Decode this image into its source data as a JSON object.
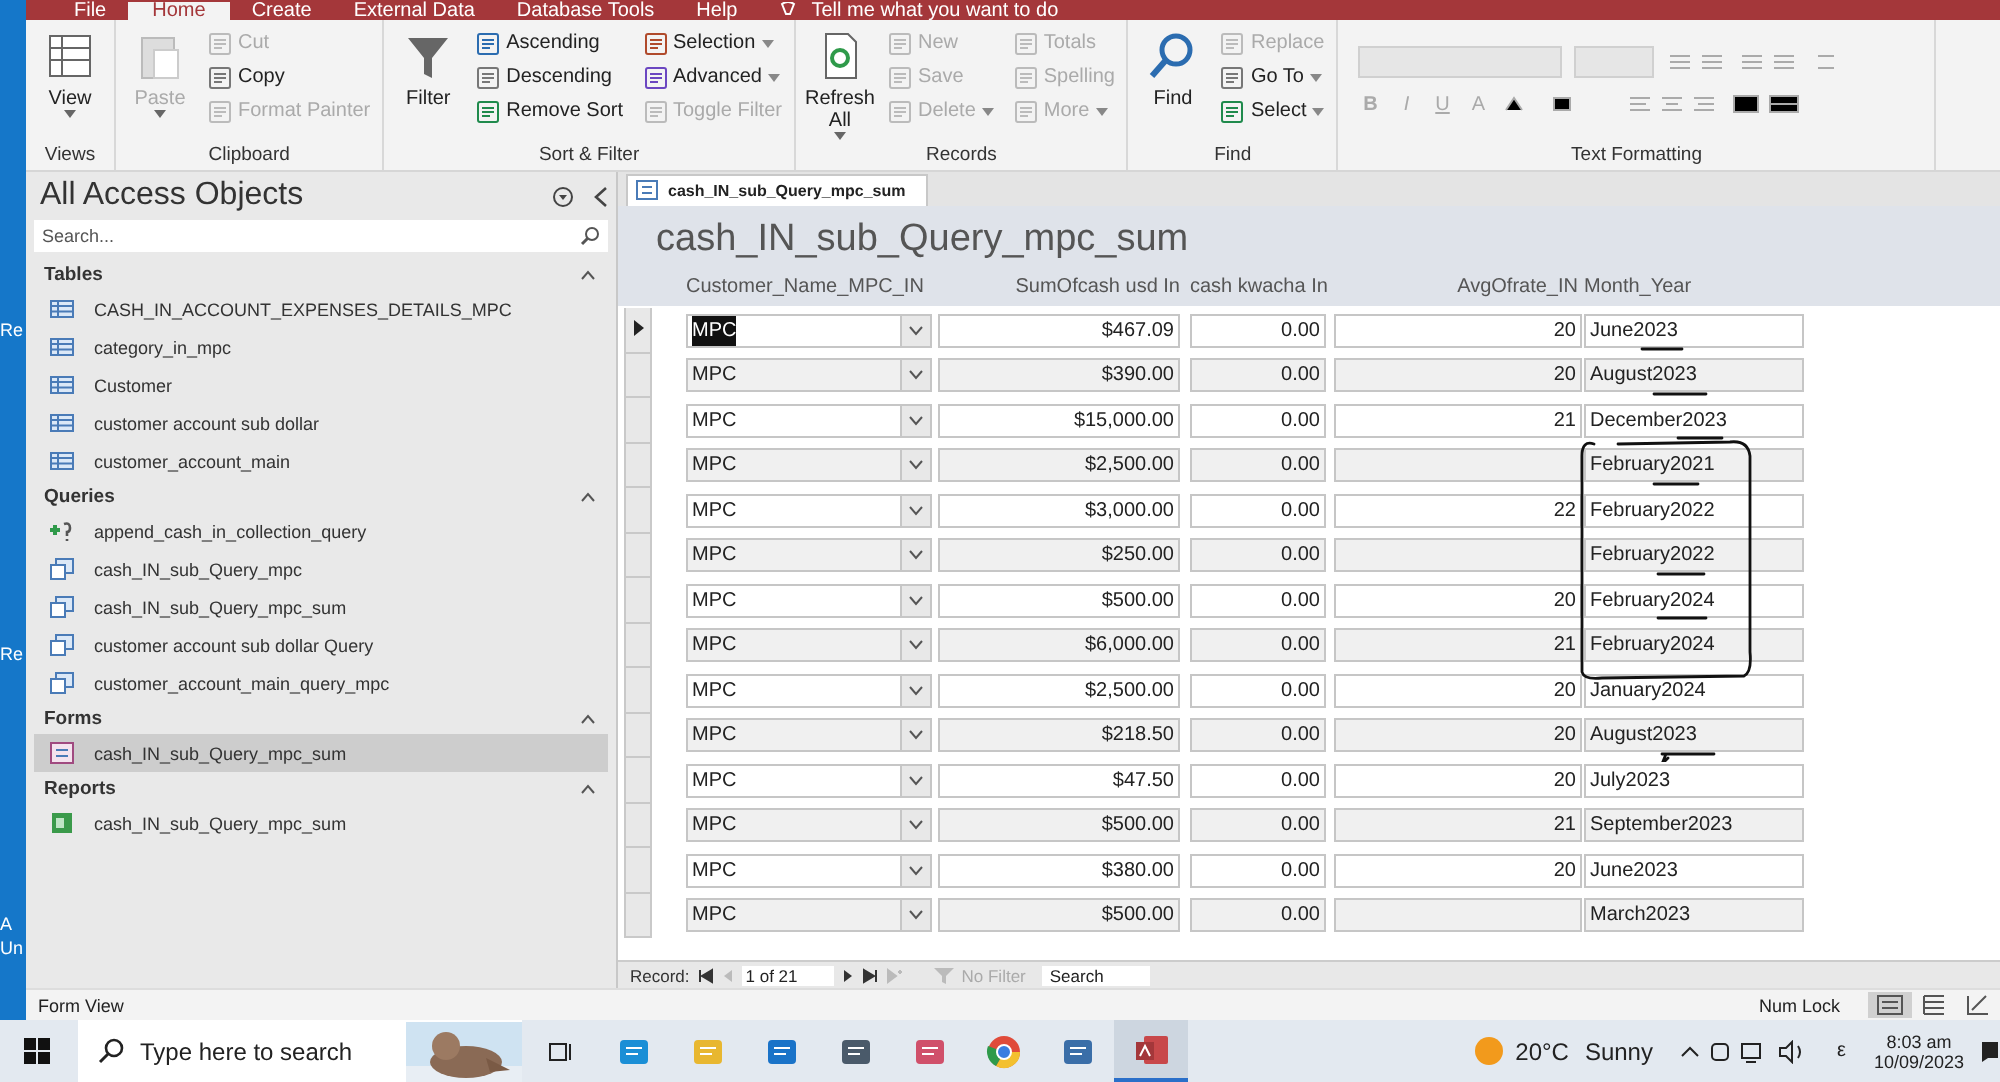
{
  "desktop_labels": [
    "Re",
    "Re",
    "A",
    "Un"
  ],
  "ribbon": {
    "tabs": [
      {
        "label": "File",
        "selected": false
      },
      {
        "label": "Home",
        "selected": true
      },
      {
        "label": "Create",
        "selected": false
      },
      {
        "label": "External Data",
        "selected": false
      },
      {
        "label": "Database Tools",
        "selected": false
      },
      {
        "label": "Help",
        "selected": false
      }
    ],
    "tell_me": "Tell me what you want to do",
    "groups": [
      {
        "label": "Views",
        "large": [
          {
            "label": "View",
            "dropdown": true,
            "disabled": false
          }
        ]
      },
      {
        "label": "Clipboard",
        "large": [
          {
            "label": "Paste",
            "dropdown": true,
            "disabled": true
          }
        ],
        "small": [
          {
            "label": "Cut",
            "dropdown": false,
            "disabled": true
          },
          {
            "label": "Copy",
            "dropdown": false,
            "disabled": false
          },
          {
            "label": "Format Painter",
            "dropdown": false,
            "disabled": true
          }
        ]
      },
      {
        "label": "Sort & Filter",
        "large": [
          {
            "label": "Filter",
            "dropdown": false,
            "disabled": false
          }
        ],
        "small": [
          {
            "label": "Ascending",
            "dropdown": false,
            "disabled": false
          },
          {
            "label": "Descending",
            "dropdown": false,
            "disabled": false
          },
          {
            "label": "Remove Sort",
            "dropdown": false,
            "disabled": false
          },
          {
            "label": "Selection",
            "dropdown": true,
            "disabled": false
          },
          {
            "label": "Advanced",
            "dropdown": true,
            "disabled": false
          },
          {
            "label": "Toggle Filter",
            "dropdown": false,
            "disabled": true
          }
        ]
      },
      {
        "label": "Records",
        "large": [
          {
            "label": "Refresh All",
            "dropdown": true,
            "disabled": false
          }
        ],
        "small": [
          {
            "label": "New",
            "dropdown": false,
            "disabled": true
          },
          {
            "label": "Save",
            "dropdown": false,
            "disabled": true
          },
          {
            "label": "Delete",
            "dropdown": true,
            "disabled": true
          },
          {
            "label": "Totals",
            "dropdown": false,
            "disabled": true
          },
          {
            "label": "Spelling",
            "dropdown": false,
            "disabled": true
          },
          {
            "label": "More",
            "dropdown": true,
            "disabled": true
          }
        ]
      },
      {
        "label": "Find",
        "large": [
          {
            "label": "Find",
            "dropdown": false,
            "disabled": false
          }
        ],
        "small": [
          {
            "label": "Replace",
            "dropdown": false,
            "disabled": true
          },
          {
            "label": "Go To",
            "dropdown": true,
            "disabled": false
          },
          {
            "label": "Select",
            "dropdown": true,
            "disabled": false
          }
        ]
      }
    ],
    "text_formatting": {
      "label": "Text Formatting",
      "letters": [
        "B",
        "I",
        "U",
        "A"
      ]
    }
  },
  "nav": {
    "title": "All Access Objects",
    "search_placeholder": "Search...",
    "sections": [
      {
        "label": "Tables",
        "items": [
          {
            "label": "CASH_IN_ACCOUNT_EXPENSES_DETAILS_MPC",
            "kind": "table",
            "selected": false
          },
          {
            "label": "category_in_mpc",
            "kind": "table",
            "selected": false
          },
          {
            "label": "Customer",
            "kind": "table",
            "selected": false
          },
          {
            "label": "customer account sub dollar",
            "kind": "table",
            "selected": false
          },
          {
            "label": "customer_account_main",
            "kind": "table",
            "selected": false
          }
        ]
      },
      {
        "label": "Queries",
        "items": [
          {
            "label": "append_cash_in_collection_query",
            "kind": "append",
            "selected": false
          },
          {
            "label": "cash_IN_sub_Query_mpc",
            "kind": "query",
            "selected": false
          },
          {
            "label": "cash_IN_sub_Query_mpc_sum",
            "kind": "query",
            "selected": false
          },
          {
            "label": "customer account sub dollar Query",
            "kind": "query",
            "selected": false
          },
          {
            "label": "customer_account_main_query_mpc",
            "kind": "query",
            "selected": false
          }
        ]
      },
      {
        "label": "Forms",
        "items": [
          {
            "label": "cash_IN_sub_Query_mpc_sum",
            "kind": "form",
            "selected": true
          }
        ]
      },
      {
        "label": "Reports",
        "items": [
          {
            "label": "cash_IN_sub_Query_mpc_sum",
            "kind": "report",
            "selected": false
          }
        ]
      }
    ]
  },
  "form": {
    "tab": "cash_IN_sub_Query_mpc_sum",
    "title": "cash_IN_sub_Query_mpc_sum",
    "columns": [
      "Customer_Name_MPC_IN",
      "SumOfcash usd In",
      "cash kwacha In",
      "AvgOfrate_IN",
      "Month_Year"
    ],
    "rows": [
      {
        "name": "MPC",
        "usd": "$467.09",
        "kwacha": "0.00",
        "rate": "20",
        "month": "June2023",
        "selected": true
      },
      {
        "name": "MPC",
        "usd": "$390.00",
        "kwacha": "0.00",
        "rate": "20",
        "month": "August2023",
        "selected": false
      },
      {
        "name": "MPC",
        "usd": "$15,000.00",
        "kwacha": "0.00",
        "rate": "21",
        "month": "December2023",
        "selected": false
      },
      {
        "name": "MPC",
        "usd": "$2,500.00",
        "kwacha": "0.00",
        "month": "February2021",
        "selected": false
      },
      {
        "name": "MPC",
        "usd": "$3,000.00",
        "kwacha": "0.00",
        "rate": "22",
        "month": "February2022",
        "selected": false
      },
      {
        "name": "MPC",
        "usd": "$250.00",
        "kwacha": "0.00",
        "month": "February2022",
        "selected": false
      },
      {
        "name": "MPC",
        "usd": "$500.00",
        "kwacha": "0.00",
        "rate": "20",
        "month": "February2024",
        "selected": false
      },
      {
        "name": "MPC",
        "usd": "$6,000.00",
        "kwacha": "0.00",
        "rate": "21",
        "month": "February2024",
        "selected": false
      },
      {
        "name": "MPC",
        "usd": "$2,500.00",
        "kwacha": "0.00",
        "rate": "20",
        "month": "January2024",
        "selected": false
      },
      {
        "name": "MPC",
        "usd": "$218.50",
        "kwacha": "0.00",
        "rate": "20",
        "month": "August2023",
        "selected": false
      },
      {
        "name": "MPC",
        "usd": "$47.50",
        "kwacha": "0.00",
        "rate": "20",
        "month": "July2023",
        "selected": false
      },
      {
        "name": "MPC",
        "usd": "$500.00",
        "kwacha": "0.00",
        "rate": "21",
        "month": "September2023",
        "selected": false
      },
      {
        "name": "MPC",
        "usd": "$380.00",
        "kwacha": "0.00",
        "rate": "20",
        "month": "June2023",
        "selected": false
      },
      {
        "name": "MPC",
        "usd": "$500.00",
        "kwacha": "0.00",
        "month": "March2023",
        "selected": false
      }
    ],
    "record_nav": {
      "label": "Record:",
      "position": "1 of 21",
      "filter": "No Filter",
      "search_placeholder": "Search"
    }
  },
  "status_bar": {
    "view": "Form View",
    "num_lock": "Num Lock"
  },
  "taskbar": {
    "search_placeholder": "Type here to search",
    "apps": [
      {
        "kind": "taskview",
        "selected": false
      },
      {
        "kind": "edge",
        "selected": false
      },
      {
        "kind": "folder",
        "selected": false
      },
      {
        "kind": "mail",
        "selected": false
      },
      {
        "kind": "calculator",
        "selected": false
      },
      {
        "kind": "snip",
        "selected": false
      },
      {
        "kind": "chrome",
        "selected": false
      },
      {
        "kind": "remote",
        "selected": false
      },
      {
        "kind": "access",
        "selected": true
      }
    ],
    "temperature": "20°C",
    "weather": "Sunny",
    "input_indicator": "ε",
    "time": "8:03 am",
    "date": "10/09/2023"
  }
}
